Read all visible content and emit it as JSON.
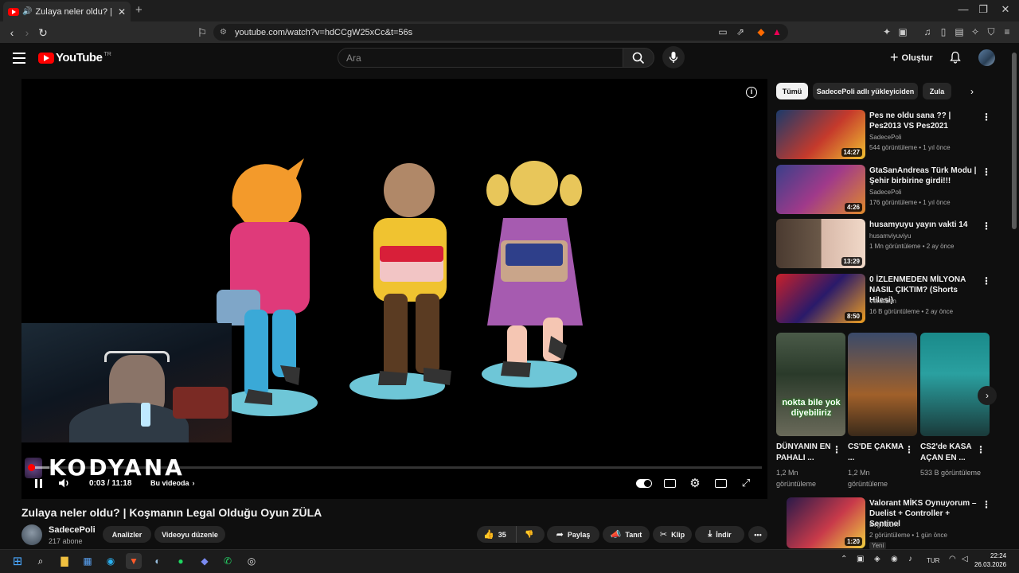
{
  "browser": {
    "tab_title": "Zulaya neler oldu? | Koşmanın",
    "url": "youtube.com/watch?v=hdCCgW25xCc&t=56s"
  },
  "header": {
    "logo_text": "YouTube",
    "logo_region": "TR",
    "search_placeholder": "Ara",
    "create_label": "Oluştur"
  },
  "player": {
    "watermark": "KODYANA",
    "time": "0:03 / 11:18",
    "chapter_label": "Bu videoda",
    "progress": 0.005,
    "buffered": 0.025
  },
  "video": {
    "title": "Zulaya neler oldu? | Koşmanın Legal Olduğu Oyun ZÜLA",
    "channel": "SadecePoli",
    "subscribers": "217 abone",
    "analytics_label": "Analizler",
    "edit_label": "Videoyu düzenle",
    "likes": "35",
    "share_label": "Paylaş",
    "promote_label": "Tanıt",
    "clip_label": "Klip",
    "download_label": "İndir"
  },
  "chips": [
    "Tümü",
    "SadecePoli adlı yükleyiciden",
    "Zula"
  ],
  "recommendations": [
    {
      "title": "Pes ne oldu sana ?? | Pes2013 VS Pes2021",
      "channel": "SadecePoli",
      "meta": "544 görüntüleme • 1 yıl önce",
      "duration": "14:27"
    },
    {
      "title": "GtaSanAndreas Türk Modu | Şehir birbirine girdi!!!",
      "channel": "SadecePoli",
      "meta": "176 görüntüleme • 1 yıl önce",
      "duration": "4:26"
    },
    {
      "title": "husamyuyu yayın vakti 14",
      "channel": "husamviyuviyu",
      "meta": "1 Mn görüntüleme • 2 ay önce",
      "duration": "13:29"
    },
    {
      "title": "0 İZLENMEDEN MİLYONA NASIL ÇIKTIM? (Shorts Hilesi)",
      "channel": "Verasben",
      "meta": "16 B görüntüleme • 2 ay önce",
      "duration": "8:50"
    },
    {
      "title": "Valorant MİKS Oynuyorum – Duelist + Controller + Sentinel",
      "channel": "EvginEDR",
      "meta": "2 görüntüleme • 1 gün önce",
      "badge": "Yeni",
      "duration": "1:20"
    }
  ],
  "shorts": [
    {
      "title": "DÜNYANIN EN PAHALI ...",
      "views": "1,2 Mn görüntüleme",
      "overlay": "nokta bile yok diyebiliriz"
    },
    {
      "title": "CS'DE ÇAKMA ...",
      "views": "1,2 Mn görüntüleme"
    },
    {
      "title": "CS2'de KASA AÇAN EN ...",
      "views": "533 B görüntüleme"
    }
  ],
  "taskbar": {
    "language": "TUR",
    "time": "22:24",
    "date": "26.03.2026"
  },
  "colors": {
    "accent": "#ff0000",
    "background": "#0f0f0f",
    "chip_active_bg": "#f1f1f1"
  },
  "icons": [
    "menu-icon",
    "search-icon",
    "mic-icon",
    "bell-icon",
    "pause-icon",
    "volume-icon",
    "like-icon",
    "dislike-icon",
    "share-icon",
    "download-icon"
  ]
}
